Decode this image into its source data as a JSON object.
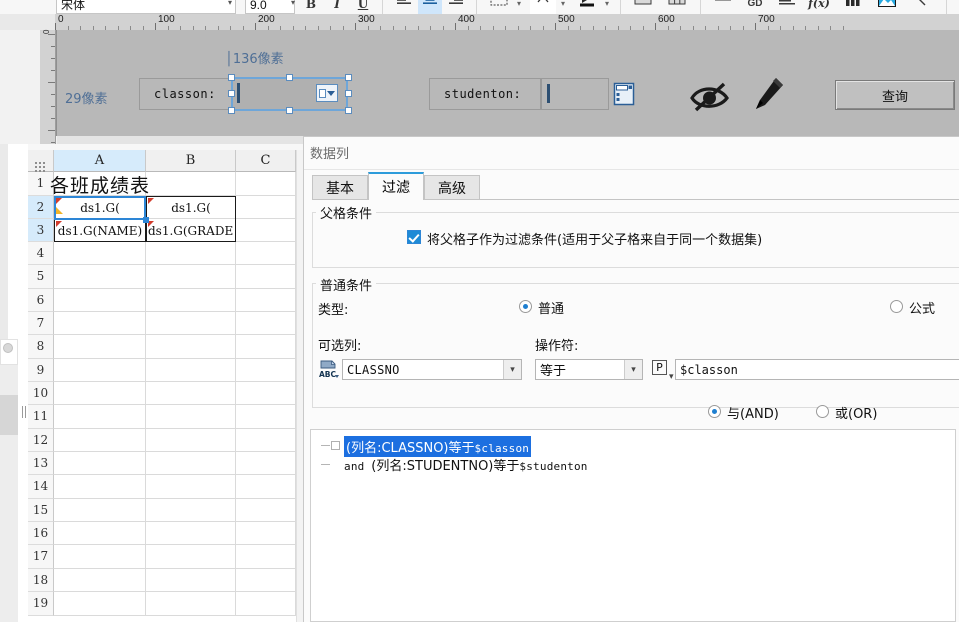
{
  "toolbar": {
    "font_name": "宋体",
    "font_size": "9.0",
    "buttons": [
      {
        "name": "bold",
        "label": "B"
      },
      {
        "name": "italic",
        "label": "I"
      },
      {
        "name": "underline",
        "label": "U"
      },
      {
        "name": "align-left",
        "label": "align-left-icon"
      },
      {
        "name": "align-center",
        "label": "align-center-icon"
      },
      {
        "name": "align-right",
        "label": "align-right-icon"
      },
      {
        "name": "borders",
        "label": "borders-icon"
      },
      {
        "name": "border-color",
        "label": "border-color-icon"
      },
      {
        "name": "fill-color",
        "label": "fill-color-icon"
      },
      {
        "name": "merge-cells",
        "label": "merge-cells-icon"
      },
      {
        "name": "split-cells",
        "label": "split-cells-icon"
      },
      {
        "name": "row-height",
        "label": "row-height-icon"
      },
      {
        "name": "hyperlink",
        "label": "hyperlink-icon"
      },
      {
        "name": "text-wrap",
        "label": "text-wrap-icon"
      },
      {
        "name": "formula",
        "label": "f(x)"
      },
      {
        "name": "chart",
        "label": "chart-icon"
      },
      {
        "name": "image",
        "label": "image-icon"
      },
      {
        "name": "diagonal-line",
        "label": "diagonal-line-icon"
      }
    ]
  },
  "canvas": {
    "ruler_h_labels": [
      "0",
      "100",
      "200",
      "300",
      "400",
      "500",
      "600",
      "700"
    ],
    "size_label_width": "136像素",
    "size_label_height": "29像素",
    "controls": {
      "classno_label": "classon:",
      "studentno_label": "studenton:",
      "query_button": "查询"
    },
    "icons": {
      "hidden": "eye-slash-icon",
      "edit": "pencil-icon"
    }
  },
  "sheet": {
    "columns": [
      "A",
      "B",
      "C"
    ],
    "rows": [
      "1",
      "2",
      "3",
      "4",
      "5",
      "6",
      "7",
      "8",
      "9",
      "10",
      "11",
      "12",
      "13",
      "14",
      "15",
      "16",
      "17",
      "18",
      "19"
    ],
    "cells": {
      "A1": "各班成绩表",
      "A2": "ds1.G(",
      "B2": "ds1.G(",
      "A3": "ds1.G(NAME)",
      "B3": "ds1.G(GRADE"
    },
    "active_column": "A",
    "active_rows": [
      "2",
      "3"
    ]
  },
  "dialog": {
    "title": "数据列",
    "tabs": [
      {
        "name": "basic",
        "label": "基本",
        "active": false
      },
      {
        "name": "filter",
        "label": "过滤",
        "active": true
      },
      {
        "name": "advanced",
        "label": "高级",
        "active": false
      }
    ],
    "parent_group": {
      "title": "父格条件",
      "checkbox_label": "将父格子作为过滤条件(适用于父子格来自于同一个数据集)",
      "checkbox_checked": true
    },
    "normal_group": {
      "title": "普通条件",
      "type_label": "类型:",
      "type_options": [
        {
          "name": "normal",
          "label": "普通",
          "selected": true
        },
        {
          "name": "formula",
          "label": "公式",
          "selected": false
        }
      ],
      "column_label": "可选列:",
      "operator_label": "操作符:",
      "column_value": "CLASSNO",
      "operator_value": "等于",
      "value_value": "$classon",
      "column_icon": "abc-column-icon",
      "param_icon": "P",
      "logic_options": [
        {
          "name": "and",
          "label": "与(AND)",
          "selected": true
        },
        {
          "name": "or",
          "label": "或(OR)",
          "selected": false
        }
      ]
    },
    "conditions": [
      {
        "prefix": "",
        "column_part": "(列名:CLASSNO)",
        "op": "等于",
        "value": "$classon",
        "selected": true
      },
      {
        "prefix": "and ",
        "column_part": "(列名:STUDENTNO)",
        "op": "等于",
        "value": "$studenton",
        "selected": false
      }
    ]
  },
  "colors": {
    "accent": "#1e8ad6",
    "tab_active_top": "#2d9cdb",
    "selection_blue": "#1c6fe0",
    "canvas_gray": "#b8b8b8",
    "ruler_gray": "#d2d2d2",
    "px_label": "#4f6f96"
  }
}
